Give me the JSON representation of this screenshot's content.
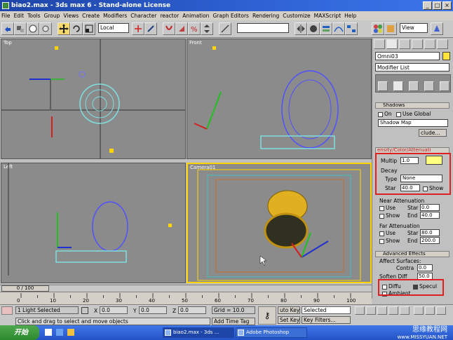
{
  "title": "biao2.max - 3ds max 6 - Stand-alone License",
  "menu": [
    "File",
    "Edit",
    "Tools",
    "Group",
    "Views",
    "Create",
    "Modifiers",
    "Character",
    "reactor",
    "Animation",
    "Graph Editors",
    "Rendering",
    "Customize",
    "MAXScript",
    "Help"
  ],
  "toolbar": {
    "ref_coord": "Local",
    "named_sel": "",
    "view_dropdown": "View"
  },
  "viewports": {
    "top": "Top",
    "front": "Front",
    "left": "Left",
    "camera": "Camera01"
  },
  "command_panel": {
    "object_name": "Omni03",
    "modifier_list": "Modifier List",
    "shadows": {
      "title": "Shadows",
      "on_label": "On",
      "use_global_label": "Use Global",
      "type": "Shadow Map",
      "exclude": "clude..."
    },
    "intensity": {
      "title": "ensity/Color/Attenuati",
      "multiplier_label": "Multip",
      "multiplier_value": "1.0",
      "decay_title": "Decay",
      "type_label": "Type",
      "type_value": "None",
      "start_label": "Star",
      "start_value": "40.0",
      "show_label": "Show"
    },
    "near_atten": {
      "title": "Near Attenuation",
      "use_label": "Use",
      "start_label": "Star",
      "start_value": "0.0",
      "show_label": "Show",
      "end_label": "End",
      "end_value": "40.0"
    },
    "far_atten": {
      "title": "Far Attenuation",
      "use_label": "Use",
      "start_label": "Star",
      "start_value": "80.0",
      "show_label": "Show",
      "end_label": "End",
      "end_value": "200.0"
    },
    "advanced": {
      "title": "Advanced Effects",
      "affect_surfaces": "Affect Surfaces:",
      "contrast_label": "Contra",
      "contrast_value": "0.0",
      "soften_label": "Soften Diff",
      "soften_value": "50.0",
      "diffuse_label": "Diffu",
      "specular_label": "Specul",
      "ambient_label": "Ambient"
    }
  },
  "timeline": {
    "slider": "0 / 100",
    "ticks": [
      "0",
      "10",
      "20",
      "30",
      "40",
      "50",
      "60",
      "70",
      "80",
      "90",
      "100"
    ],
    "progress_fraction": 0
  },
  "status": {
    "selected": "1 Light Selected",
    "x_label": "X",
    "x_value": "0.0",
    "y_label": "Y",
    "y_value": "0.0",
    "z_label": "Z",
    "z_value": "0.0",
    "grid": "Grid = 10.0",
    "auto_key": "uto Key",
    "selected_dropdown": "Selected",
    "set_key": "Set Key",
    "key_filters": "Key Filters...",
    "prompt": "Click and drag to select and move objects",
    "add_time_tag": "Add Time Tag"
  },
  "taskbar": {
    "start": "开始",
    "item1": "biao2.max - 3ds ...",
    "item2": "Adobe Photoshop"
  },
  "watermark": {
    "line1": "思缘教程网",
    "line2": "www.MISSYUAN.NET"
  },
  "colors": {
    "selection_red": "#e02020",
    "active_yellow": "#f6d86b",
    "viewport_bg": "#8b8b8b",
    "camera_border": "#ffd400"
  }
}
